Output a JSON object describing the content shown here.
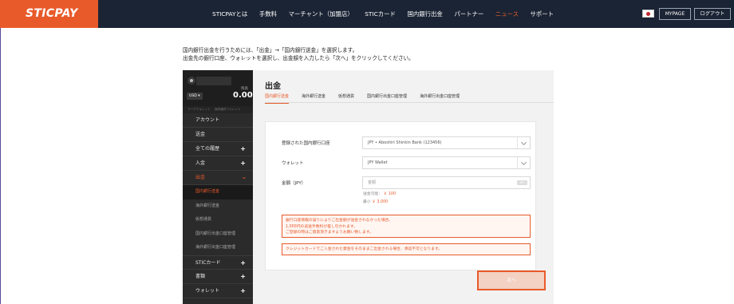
{
  "header": {
    "logo": "STICPAY",
    "nav": [
      {
        "label": "STICPAYとは",
        "active": false
      },
      {
        "label": "手数料",
        "active": false
      },
      {
        "label": "マーチャント（加盟店）",
        "active": false
      },
      {
        "label": "STICカード",
        "active": false
      },
      {
        "label": "国内銀行出金",
        "active": false
      },
      {
        "label": "パートナー",
        "active": false
      },
      {
        "label": "ニュース",
        "active": true
      },
      {
        "label": "サポート",
        "active": false
      }
    ],
    "flag_icon": "japan-flag-icon",
    "mypage_label": "MYPAGE",
    "logout_label": "ログアウト"
  },
  "instructions": {
    "line1": "国内銀行出金を行うためには、「出金」→「国内銀行送金」を選択します。",
    "line2": "出金先の銀行口座、ウォレットを選択し、出金額を入力したら「次へ」をクリックしてください。"
  },
  "screenshot": {
    "sidebar": {
      "balance_label": "残高",
      "currency": "USD",
      "amount": "0.00",
      "subtabs": [
        "マークウォレット",
        "保有通貨ウォレット"
      ],
      "menu": [
        {
          "label": "アカウント",
          "plus": false,
          "active": false
        },
        {
          "label": "送金",
          "plus": false,
          "active": false
        },
        {
          "label": "全ての履歴",
          "plus": true,
          "active": false
        },
        {
          "label": "入金",
          "plus": true,
          "active": false
        },
        {
          "label": "出金",
          "plus": true,
          "active": true,
          "toggle": "–"
        }
      ],
      "submenu": [
        {
          "label": "国内銀行送金",
          "active": true
        },
        {
          "label": "海外銀行送金",
          "active": false
        },
        {
          "label": "仮想通貨",
          "active": false
        },
        {
          "label": "国内銀行出金口座管理",
          "active": false
        },
        {
          "label": "海外銀行出金口座管理",
          "active": false
        }
      ],
      "menu_bottom": [
        {
          "label": "STICカード",
          "plus": true
        },
        {
          "label": "書類",
          "plus": true
        },
        {
          "label": "ウォレット",
          "plus": true
        }
      ]
    },
    "main": {
      "title": "出金",
      "tabs": [
        {
          "label": "国内銀行送金",
          "active": true
        },
        {
          "label": "海外銀行送金",
          "active": false
        },
        {
          "label": "仮想通貨",
          "active": false
        },
        {
          "label": "国内銀行出金口座管理",
          "active": false
        },
        {
          "label": "海外銀行出金口座管理",
          "active": false
        }
      ],
      "form": {
        "bank_label": "登録された国内銀行口座",
        "bank_value": "JPY • Aboshiri Shinkin Bank (123456)",
        "wallet_label": "ウォレット",
        "wallet_value": "JPY Wallet",
        "amount_label": "金額（JPY）",
        "amount_placeholder": "金額",
        "amount_badge": "JPY",
        "hint_available_label": "送金可能：",
        "hint_available_value": "￥ 100",
        "hint_min_label": "最小",
        "hint_min_value": "￥ 3,000"
      },
      "warning": [
        "銀行口座情報の誤りによりご出金額が送金されなかった場合、",
        "1,000円の返送手数料が差し引かれます。",
        "ご登録の際はご留意頂きますようお願い致します。"
      ],
      "note": "クレジットカードでご入金された資金をそのままご出金される場合、承認不可となります。",
      "next_label": "次へ"
    }
  }
}
